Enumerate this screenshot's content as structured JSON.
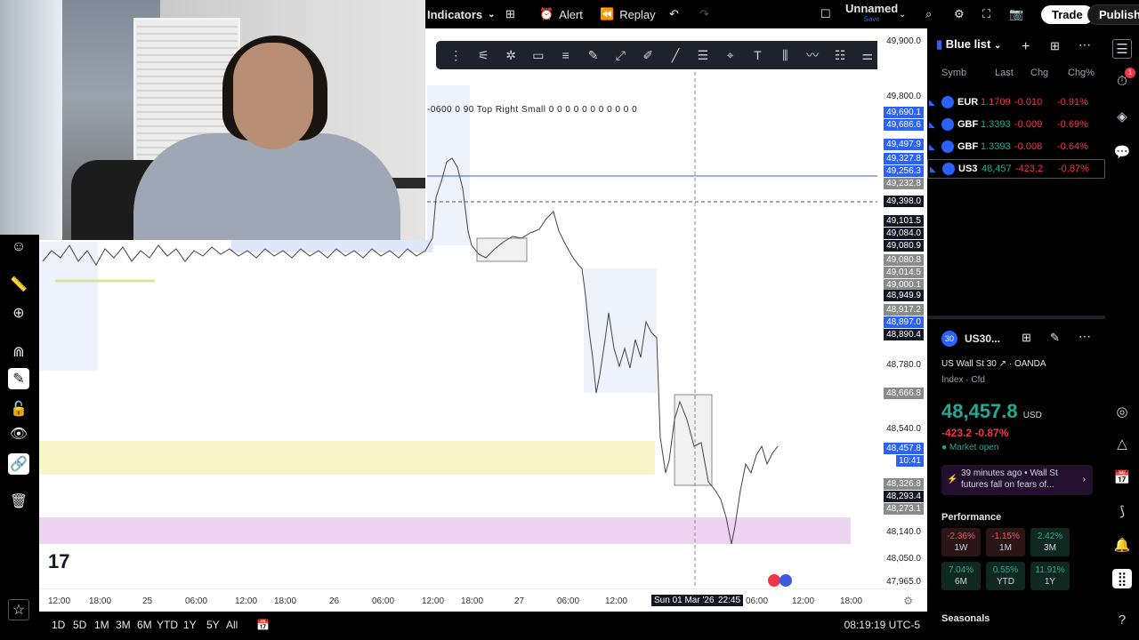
{
  "topbar": {
    "indicators": "Indicators",
    "alert": "Alert",
    "replay": "Replay",
    "layout_name": "Unnamed",
    "layout_sub": "Save",
    "trade": "Trade",
    "publish": "Publish"
  },
  "chart": {
    "annotation": "-0600 0 90 Top Right Small  0 0 0 0 0 0 0 0 0 0 0",
    "price_labels": [
      {
        "text": "49,900.0",
        "style": "plain"
      },
      {
        "text": "49,800.0",
        "style": "plain"
      },
      {
        "text": "49,690.1",
        "style": "blue"
      },
      {
        "text": "49,686.6",
        "style": "blue"
      },
      {
        "text": "49,497.9",
        "style": "blue"
      },
      {
        "text": "49,327.8",
        "style": "blue"
      },
      {
        "text": "49,256.3",
        "style": "blue"
      },
      {
        "text": "49,232.8",
        "style": "grey"
      },
      {
        "text": "49,398.0",
        "style": "dark"
      },
      {
        "text": "49,101.5",
        "style": "dark"
      },
      {
        "text": "49,084.0",
        "style": "dark"
      },
      {
        "text": "49,080.9",
        "style": "dark"
      },
      {
        "text": "49,080.8",
        "style": "grey"
      },
      {
        "text": "49,014.5",
        "style": "grey"
      },
      {
        "text": "49,000.1",
        "style": "grey"
      },
      {
        "text": "48,949.9",
        "style": "dark"
      },
      {
        "text": "48,917.2",
        "style": "grey"
      },
      {
        "text": "48,897.0",
        "style": "blue"
      },
      {
        "text": "48,890.4",
        "style": "dark"
      },
      {
        "text": "48,780.0",
        "style": "plain"
      },
      {
        "text": "48,666.8",
        "style": "grey"
      },
      {
        "text": "48,540.0",
        "style": "plain"
      },
      {
        "text": "48,457.8",
        "style": "blue"
      },
      {
        "text": "10:41",
        "style": "blue"
      },
      {
        "text": "48,326.8",
        "style": "grey"
      },
      {
        "text": "48,293.4",
        "style": "dark"
      },
      {
        "text": "48,273.1",
        "style": "grey"
      },
      {
        "text": "48,140.0",
        "style": "plain"
      },
      {
        "text": "48,050.0",
        "style": "plain"
      },
      {
        "text": "47,965.0",
        "style": "plain"
      }
    ],
    "time_labels": [
      "12:00",
      "18:00",
      "25",
      "06:00",
      "12:00",
      "18:00",
      "26",
      "06:00",
      "12:00",
      "18:00",
      "27",
      "06:00",
      "12:00",
      "Sun 01 Mar '26",
      "22:45",
      "06:00",
      "12:00",
      "18:00"
    ]
  },
  "bottom": {
    "ranges": [
      "1D",
      "5D",
      "1M",
      "3M",
      "6M",
      "YTD",
      "1Y",
      "5Y",
      "All"
    ],
    "clock": "08:19:19 UTC-5"
  },
  "watchlist": {
    "title": "Blue list",
    "columns": [
      "Symb",
      "Last",
      "Chg",
      "Chg%"
    ],
    "rows": [
      {
        "symbol": "EUR",
        "last": "1.1709",
        "chg": "-0.010",
        "chgp": "-0.91%"
      },
      {
        "symbol": "GBF",
        "last": "1.3393",
        "chg": "-0.009",
        "chgp": "-0.69%"
      },
      {
        "symbol": "GBF",
        "last": "1.3393",
        "chg": "-0.008",
        "chgp": "-0.64%"
      },
      {
        "symbol": "US3",
        "last": "48,457",
        "chg": "-423.2",
        "chgp": "-0.87%"
      }
    ]
  },
  "details": {
    "badge": "30",
    "symbol": "US30...",
    "name": "US Wall St 30",
    "broker": "OANDA",
    "type": "Index · Cfd",
    "price": "48,457.8",
    "currency": "USD",
    "change": "-423.2  -0.87%",
    "market_status": "Market open",
    "news_time": "39 minutes ago",
    "news_source": "Wall St",
    "news_headline": "futures fall on fears of...",
    "performance_title": "Performance",
    "performance": [
      {
        "value": "-2.36%",
        "period": "1W",
        "kind": "neg"
      },
      {
        "value": "-1.15%",
        "period": "1M",
        "kind": "neg"
      },
      {
        "value": "2.42%",
        "period": "3M",
        "kind": "pos"
      },
      {
        "value": "7.04%",
        "period": "6M",
        "kind": "pos"
      },
      {
        "value": "0.55%",
        "period": "YTD",
        "kind": "pos"
      },
      {
        "value": "11.91%",
        "period": "1Y",
        "kind": "pos"
      }
    ],
    "seasonals": "Seasonals"
  },
  "badges": {
    "notifications": "1"
  },
  "colors": {
    "accent": "#2962ff",
    "up": "#22ab94",
    "down": "#f23645"
  }
}
